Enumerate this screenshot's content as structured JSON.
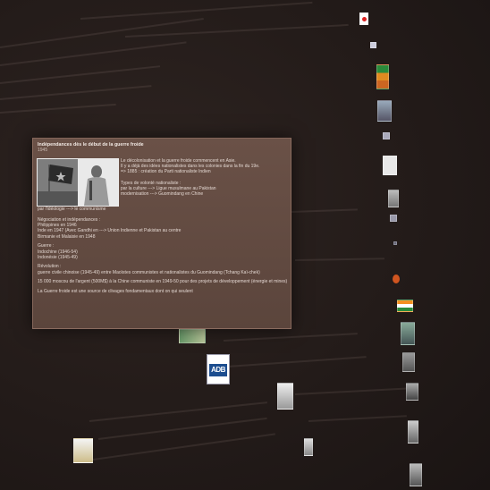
{
  "card": {
    "title": "Indépendances dès le début de la guerre froide",
    "subtitle": "1945",
    "right_lines": [
      "Le décolonisation et la guerre froide commencent en Asie.",
      "Il y a déjà des idées nationalistes dans les colonies dans la fin du 19e.",
      "=> 1885 : création du Parti nationaliste Indien",
      "",
      "Types de volonté nationaliste :",
      "par la culture ---> Ligue musulmane au Pakistan",
      "modernisation ---> Guomindang en Chine"
    ],
    "caption": "par l'idéologie ---> le communisme",
    "paragraphs": [
      [
        "Négociation et indépendances :",
        "Philippines en 1946",
        "Inde en 1947 (Avec Gandhi en ---> Union Indienne et Pakistan au centre",
        "Birmanie et Malaisie en 1948"
      ],
      [
        "Guerre :",
        "Indochine (1946-54)",
        "Indonésie (1945-49)"
      ],
      [
        "Révolution :",
        "guerre civile chinoise (1945-49) entre Maoïstes communistes et nationalistes du Guomindang (Tchang Kaï-chek)"
      ],
      [
        "15 000 moscou de l'argent (500M$) à la Chine communiste en 1949-50 pour des projets de développement (énergie et mines)"
      ],
      [
        "La Guerre froide est une source de clivages fondamentaux dont on qui seulent"
      ]
    ]
  },
  "adb": {
    "logo_text": "ADB"
  },
  "colors": {
    "background": "#231b19",
    "card": "#5f483f",
    "card_border": "#a07d6e"
  },
  "icons": [
    "flag-icon",
    "photo-thumbnail",
    "map-thumbnail",
    "adb-logo"
  ]
}
